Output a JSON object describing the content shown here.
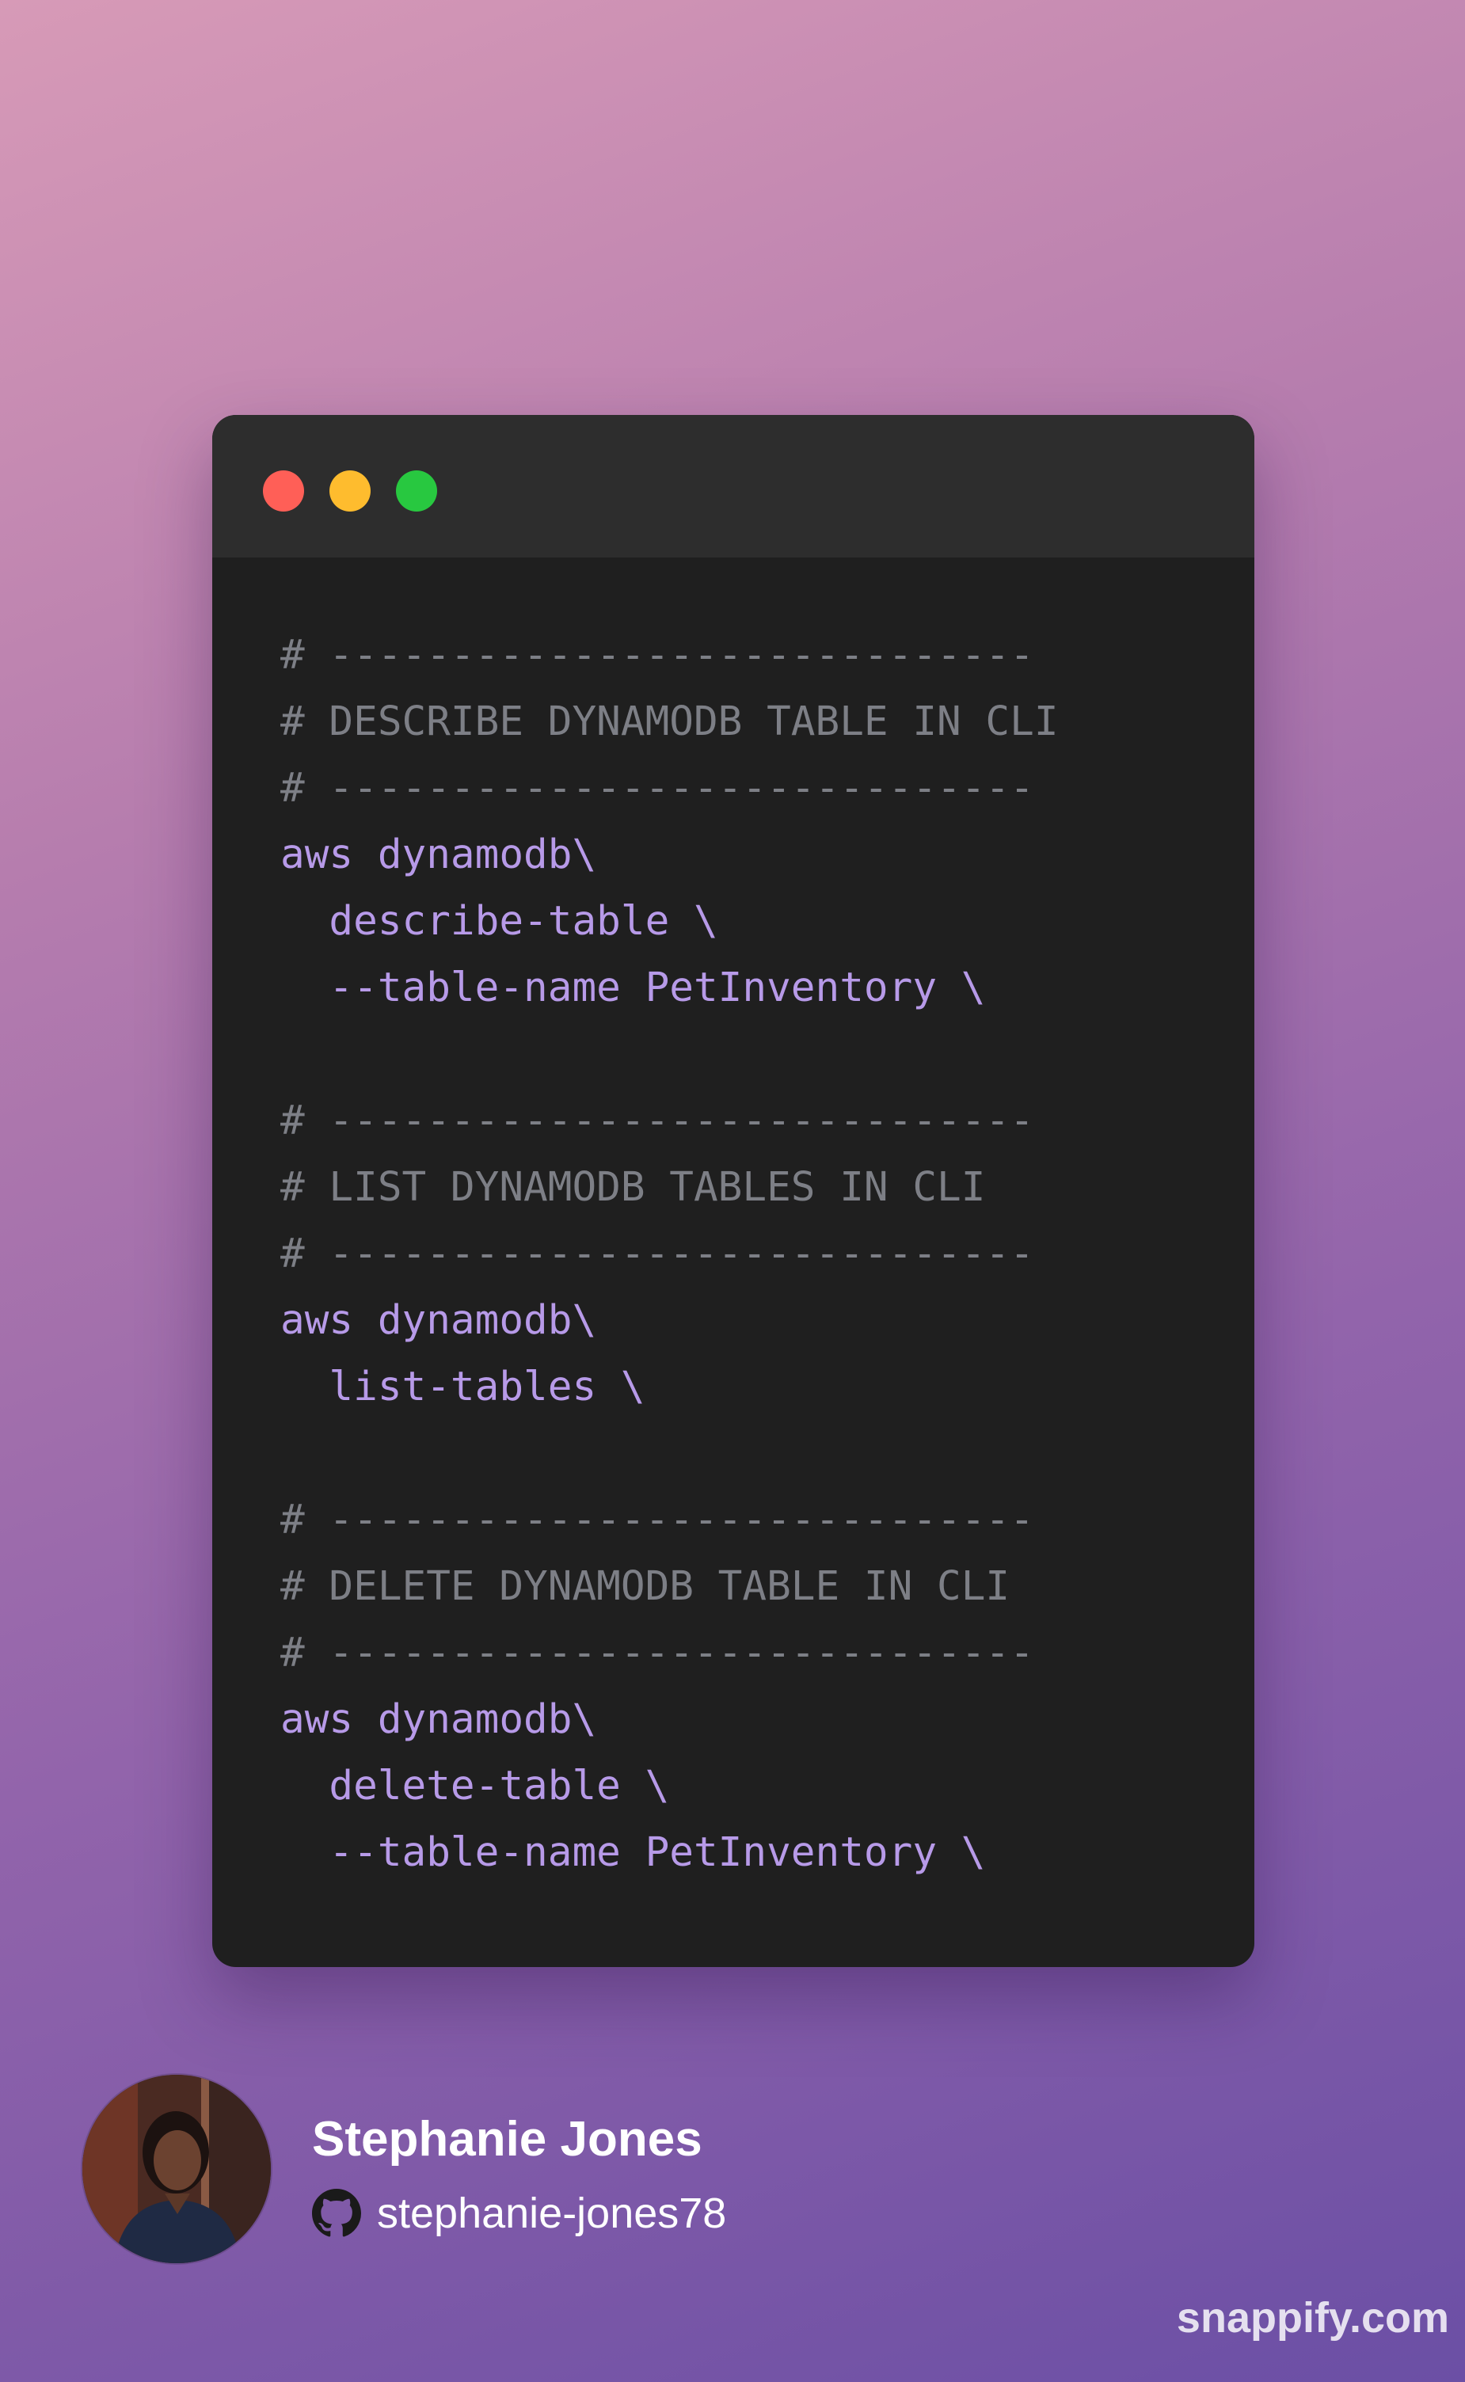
{
  "window": {
    "controls": [
      {
        "name": "close",
        "color": "#ff5f57"
      },
      {
        "name": "minimize",
        "color": "#febc2e"
      },
      {
        "name": "zoom",
        "color": "#28c840"
      }
    ]
  },
  "colors": {
    "comment": "#7d7f86",
    "command": "#b79ae8",
    "window_bg": "#1f1f1f",
    "titlebar_bg": "#2d2d2d"
  },
  "code": {
    "lines": [
      {
        "text": "# -----------------------------",
        "kind": "comment"
      },
      {
        "text": "# DESCRIBE DYNAMODB TABLE IN CLI",
        "kind": "comment"
      },
      {
        "text": "# -----------------------------",
        "kind": "comment"
      },
      {
        "text": "aws dynamodb\\",
        "kind": "cmd"
      },
      {
        "text": "  describe-table \\",
        "kind": "cmd"
      },
      {
        "text": "  --table-name PetInventory \\",
        "kind": "cmd"
      },
      {
        "text": "",
        "kind": "blank"
      },
      {
        "text": "# -----------------------------",
        "kind": "comment"
      },
      {
        "text": "# LIST DYNAMODB TABLES IN CLI",
        "kind": "comment"
      },
      {
        "text": "# -----------------------------",
        "kind": "comment"
      },
      {
        "text": "aws dynamodb\\",
        "kind": "cmd"
      },
      {
        "text": "  list-tables \\",
        "kind": "cmd"
      },
      {
        "text": "",
        "kind": "blank"
      },
      {
        "text": "# -----------------------------",
        "kind": "comment"
      },
      {
        "text": "# DELETE DYNAMODB TABLE IN CLI",
        "kind": "comment"
      },
      {
        "text": "# -----------------------------",
        "kind": "comment"
      },
      {
        "text": "aws dynamodb\\",
        "kind": "cmd"
      },
      {
        "text": "  delete-table \\",
        "kind": "cmd"
      },
      {
        "text": "  --table-name PetInventory \\",
        "kind": "cmd"
      }
    ]
  },
  "author": {
    "name": "Stephanie Jones",
    "github_icon": "github-icon",
    "github_handle": "stephanie-jones78"
  },
  "brand": {
    "text": "snappify.com"
  }
}
